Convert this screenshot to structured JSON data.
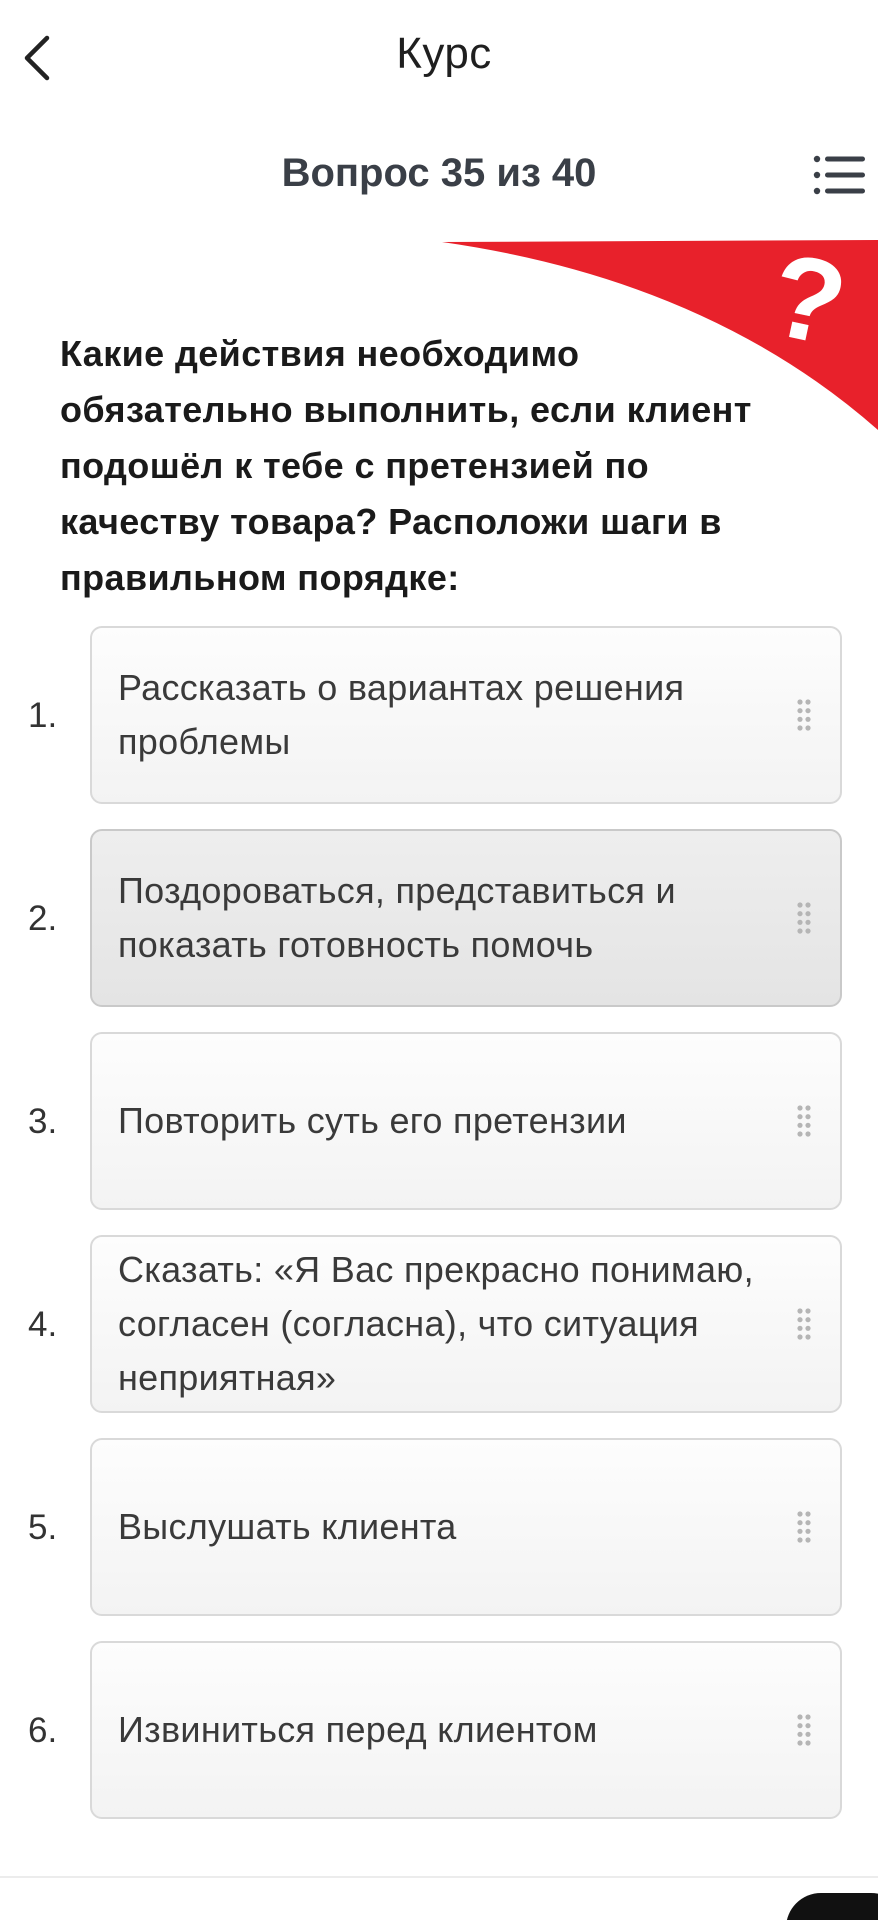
{
  "app_bar": {
    "title": "Курс",
    "back_icon": "chevron-left-icon"
  },
  "question_header": {
    "counter": "Вопрос 35 из 40",
    "menu_icon": "list-menu-icon"
  },
  "banner": {
    "color": "#e8212b",
    "symbol": "?"
  },
  "question": {
    "text": "Какие действия необходимо обязательно выполнить, если клиент подошёл к тебе с претензией по качеству товара? Расположи шаги в правильном порядке:"
  },
  "answers": [
    {
      "number": "1.",
      "text": "Рассказать о вариантах решения проблемы"
    },
    {
      "number": "2.",
      "text": "Поздороваться, представиться и показать готовность помочь",
      "active": true
    },
    {
      "number": "3.",
      "text": "Повторить суть его претензии"
    },
    {
      "number": "4.",
      "text": "Сказать: «Я Вас прекрасно понимаю, согласен (согласна), что ситуация неприятная»"
    },
    {
      "number": "5.",
      "text": "Выслушать клиента"
    },
    {
      "number": "6.",
      "text": "Извиниться перед клиентом"
    }
  ],
  "drag_handle_icon": "drag-handle-icon"
}
